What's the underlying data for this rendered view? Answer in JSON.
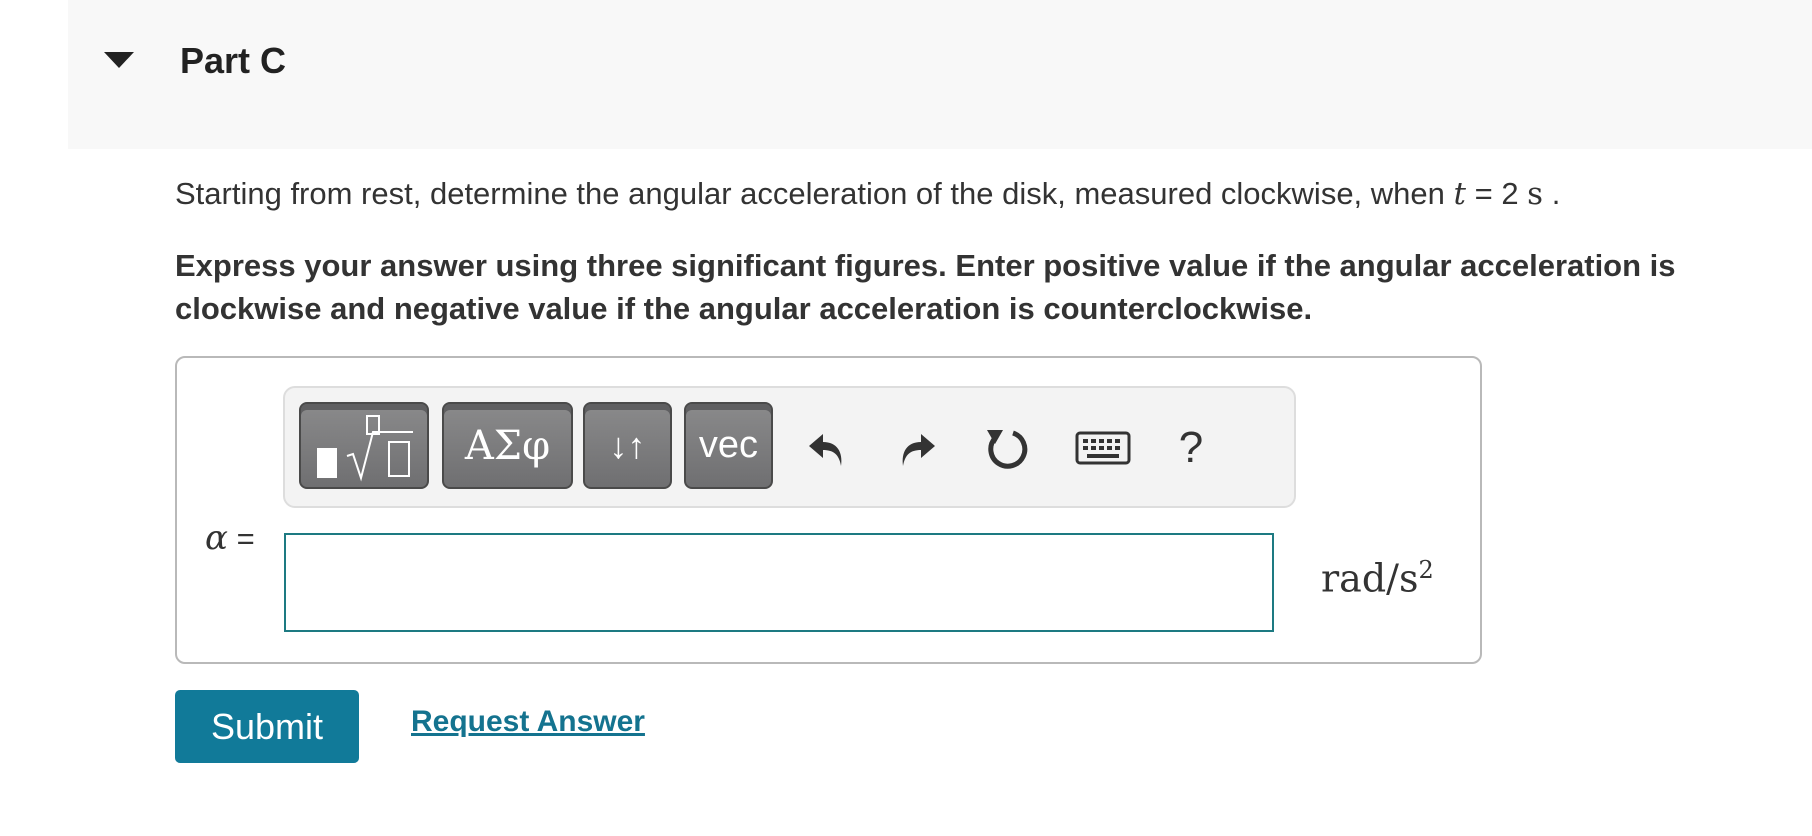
{
  "header": {
    "title": "Part C",
    "caret_icon": "caret-down-icon"
  },
  "question": {
    "text": "Starting from rest, determine the angular acceleration of the disk, measured clockwise, when ",
    "var": "t",
    "equals": " = 2 ",
    "unit": "s",
    "end": " ."
  },
  "instruction": "Express your answer using three significant figures. Enter positive value if the angular acceleration is clockwise and negative value if the angular acceleration is counterclockwise.",
  "toolbar": {
    "greek_label": "ΑΣφ",
    "arrows_label": "↓↑",
    "vec_label": "vec",
    "undo_icon": "undo-icon",
    "redo_icon": "redo-icon",
    "reset_icon": "reset-icon",
    "keyboard_icon": "keyboard-icon",
    "help_label": "?"
  },
  "answer": {
    "label_symbol": "α",
    "label_equals": " =",
    "value": "",
    "unit_main": "rad/s",
    "unit_exp": "2"
  },
  "actions": {
    "submit_label": "Submit",
    "request_label": "Request Answer"
  },
  "colors": {
    "accent": "#117a99",
    "input_border": "#1d7a82",
    "link": "#14738f"
  }
}
